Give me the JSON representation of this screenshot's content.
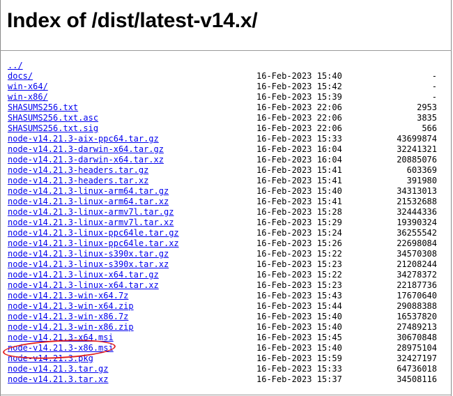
{
  "page": {
    "title": "Index of /dist/latest-v14.x/"
  },
  "parent_link": "../",
  "files": [
    {
      "name": "docs/",
      "date": "16-Feb-2023 15:40",
      "size": "-"
    },
    {
      "name": "win-x64/",
      "date": "16-Feb-2023 15:42",
      "size": "-"
    },
    {
      "name": "win-x86/",
      "date": "16-Feb-2023 15:39",
      "size": "-"
    },
    {
      "name": "SHASUMS256.txt",
      "date": "16-Feb-2023 22:06",
      "size": "2953"
    },
    {
      "name": "SHASUMS256.txt.asc",
      "date": "16-Feb-2023 22:06",
      "size": "3835"
    },
    {
      "name": "SHASUMS256.txt.sig",
      "date": "16-Feb-2023 22:06",
      "size": "566"
    },
    {
      "name": "node-v14.21.3-aix-ppc64.tar.gz",
      "date": "16-Feb-2023 15:33",
      "size": "43699874"
    },
    {
      "name": "node-v14.21.3-darwin-x64.tar.gz",
      "date": "16-Feb-2023 16:04",
      "size": "32241321"
    },
    {
      "name": "node-v14.21.3-darwin-x64.tar.xz",
      "date": "16-Feb-2023 16:04",
      "size": "20885076"
    },
    {
      "name": "node-v14.21.3-headers.tar.gz",
      "date": "16-Feb-2023 15:41",
      "size": "603369"
    },
    {
      "name": "node-v14.21.3-headers.tar.xz",
      "date": "16-Feb-2023 15:41",
      "size": "391980"
    },
    {
      "name": "node-v14.21.3-linux-arm64.tar.gz",
      "date": "16-Feb-2023 15:40",
      "size": "34313013"
    },
    {
      "name": "node-v14.21.3-linux-arm64.tar.xz",
      "date": "16-Feb-2023 15:41",
      "size": "21532688"
    },
    {
      "name": "node-v14.21.3-linux-armv7l.tar.gz",
      "date": "16-Feb-2023 15:28",
      "size": "32444336"
    },
    {
      "name": "node-v14.21.3-linux-armv7l.tar.xz",
      "date": "16-Feb-2023 15:29",
      "size": "19390324"
    },
    {
      "name": "node-v14.21.3-linux-ppc64le.tar.gz",
      "date": "16-Feb-2023 15:24",
      "size": "36255542"
    },
    {
      "name": "node-v14.21.3-linux-ppc64le.tar.xz",
      "date": "16-Feb-2023 15:26",
      "size": "22698084"
    },
    {
      "name": "node-v14.21.3-linux-s390x.tar.gz",
      "date": "16-Feb-2023 15:22",
      "size": "34570308"
    },
    {
      "name": "node-v14.21.3-linux-s390x.tar.xz",
      "date": "16-Feb-2023 15:23",
      "size": "21208244"
    },
    {
      "name": "node-v14.21.3-linux-x64.tar.gz",
      "date": "16-Feb-2023 15:22",
      "size": "34278372"
    },
    {
      "name": "node-v14.21.3-linux-x64.tar.xz",
      "date": "16-Feb-2023 15:23",
      "size": "22187736"
    },
    {
      "name": "node-v14.21.3-win-x64.7z",
      "date": "16-Feb-2023 15:43",
      "size": "17670640"
    },
    {
      "name": "node-v14.21.3-win-x64.zip",
      "date": "16-Feb-2023 15:44",
      "size": "29088388"
    },
    {
      "name": "node-v14.21.3-win-x86.7z",
      "date": "16-Feb-2023 15:40",
      "size": "16537820"
    },
    {
      "name": "node-v14.21.3-win-x86.zip",
      "date": "16-Feb-2023 15:40",
      "size": "27489213"
    },
    {
      "name": "node-v14.21.3-x64.msi",
      "date": "16-Feb-2023 15:45",
      "size": "30670848"
    },
    {
      "name": "node-v14.21.3-x86.msi",
      "date": "16-Feb-2023 15:40",
      "size": "28975104"
    },
    {
      "name": "node-v14.21.3.pkg",
      "date": "16-Feb-2023 15:59",
      "size": "32427197"
    },
    {
      "name": "node-v14.21.3.tar.gz",
      "date": "16-Feb-2023 15:33",
      "size": "64736018"
    },
    {
      "name": "node-v14.21.3.tar.xz",
      "date": "16-Feb-2023 15:37",
      "size": "34508116"
    }
  ],
  "highlighted_file": "node-v14.21.3-x86.msi",
  "colors": {
    "link": "#0000ee",
    "highlight": "#e02020"
  }
}
